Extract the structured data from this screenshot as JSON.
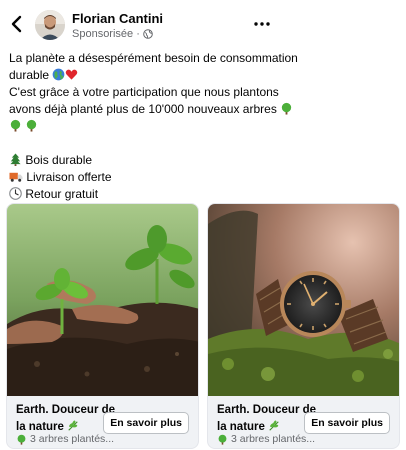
{
  "header": {
    "page_name": "Florian Cantini",
    "sponsored_label": "Sponsorisée · ",
    "icons": {
      "back": "back-arrow-icon",
      "more": "more-options-icon",
      "audience": "globe-icon"
    }
  },
  "post": {
    "line1": "La planète a désespérément besoin de consommation",
    "line2": "durable",
    "line3": "C'est grâce à votre participation que nous plantons",
    "line4": "avons déjà planté plus de 10'000 nouveaux arbres",
    "features": [
      "Bois durable",
      "Livraison offerte",
      "Retour gratuit"
    ],
    "feature_icons": [
      "evergreen-tree-icon",
      "delivery-truck-icon",
      "clock-icon"
    ]
  },
  "cards": [
    {
      "title": "Earth. Douceur de la nature",
      "subtitle": "3 arbres plantés...",
      "button": "En savoir plus",
      "image": "hands-planting-seedling"
    },
    {
      "title": "Earth. Douceur de la nature",
      "subtitle": "3 arbres plantés...",
      "button": "En savoir plus",
      "image": "wooden-watch-on-moss"
    }
  ],
  "colors": {
    "text": "#050505",
    "secondary": "#65676b",
    "card_bg": "#f0f2f5",
    "border": "#bcc0c4"
  }
}
